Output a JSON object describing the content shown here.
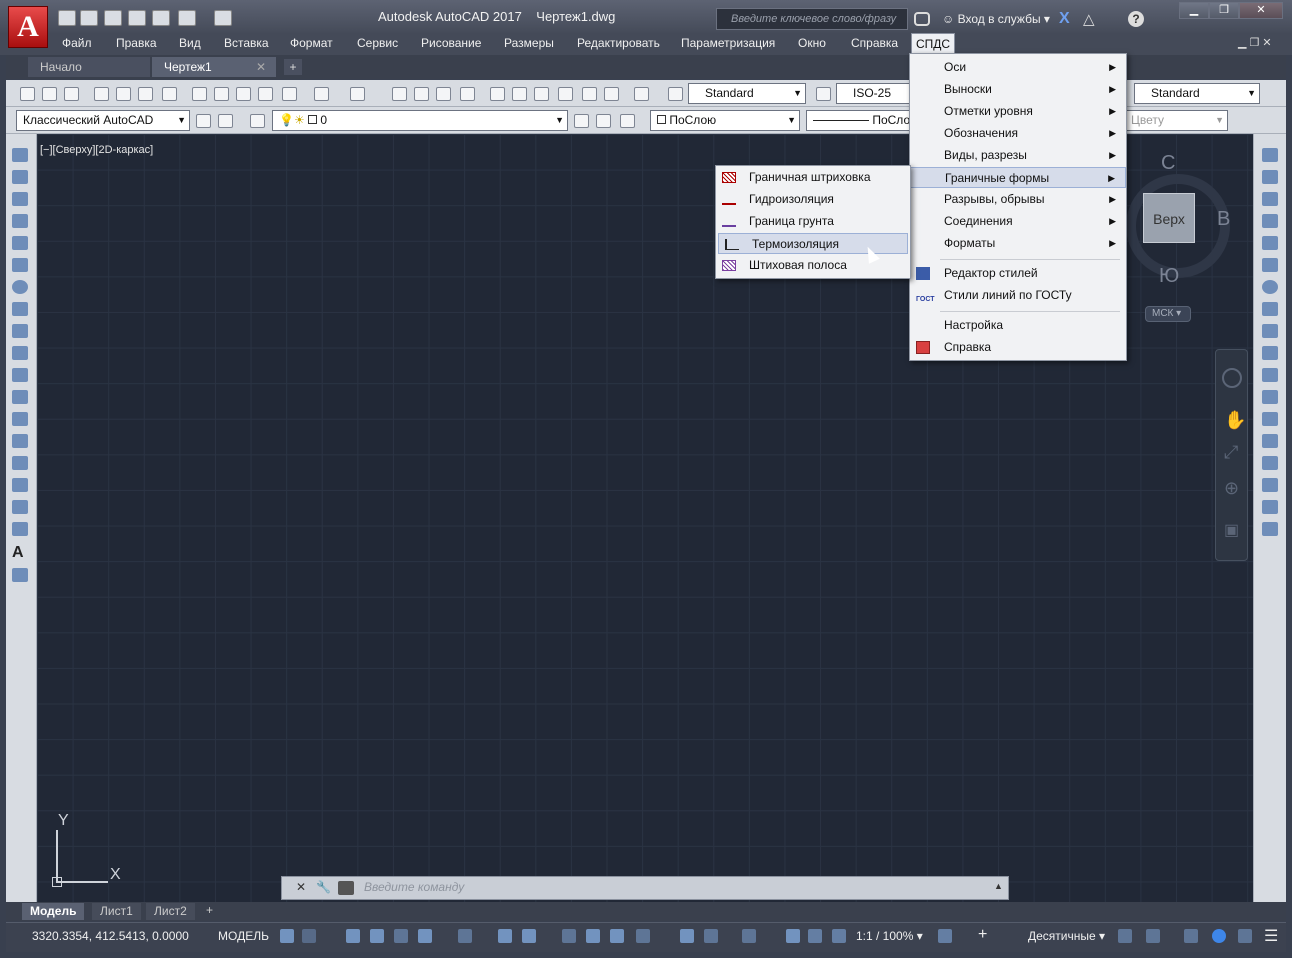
{
  "title": {
    "app": "Autodesk AutoCAD 2017",
    "file": "Чертеж1.dwg"
  },
  "search": {
    "placeholder": "Введите ключевое слово/фразу"
  },
  "signin": "Вход в службы",
  "menubar": [
    "Файл",
    "Правка",
    "Вид",
    "Вставка",
    "Формат",
    "Сервис",
    "Рисование",
    "Размеры",
    "Редактировать",
    "Параметризация",
    "Окно",
    "Справка",
    "СПДС"
  ],
  "tabs": [
    "Начало",
    "Чертеж1"
  ],
  "toolbar": {
    "textstyle": "Standard",
    "dimstyle": "ISO-25",
    "tablestyle": "Standard",
    "workspace": "Классический AutoCAD",
    "layer": "0",
    "color": "ПоСлою",
    "linetype": "ПоСло",
    "plotstyle": "Цвету"
  },
  "viewport_label": "[−][Сверху][2D-каркас]",
  "viewcube": {
    "face": "Верх",
    "north": "С",
    "east": "В",
    "south": "Ю",
    "ucs": "МСК"
  },
  "ucs": {
    "x": "X",
    "y": "Y"
  },
  "dropdown": {
    "items": [
      "Оси",
      "Выноски",
      "Отметки уровня",
      "Обозначения",
      "Виды, разрезы",
      "Граничные формы",
      "Разрывы, обрывы",
      "Соединения",
      "Форматы",
      "Редактор стилей",
      "Стили линий по ГОСТу",
      "Настройка",
      "Справка"
    ]
  },
  "submenu": {
    "items": [
      "Граничная штриховка",
      "Гидроизоляция",
      "Граница грунта",
      "Термоизоляция",
      "Штиховая полоса"
    ]
  },
  "command": {
    "placeholder": "Введите  команду"
  },
  "layouts": [
    "Модель",
    "Лист1",
    "Лист2"
  ],
  "status": {
    "coords": "3320.3354, 412.5413, 0.0000",
    "space": "МОДЕЛЬ",
    "scale": "1:1 / 100%",
    "units": "Десятичные"
  },
  "colors": {
    "canvas": "#212836",
    "accent": "#d6dcea"
  }
}
